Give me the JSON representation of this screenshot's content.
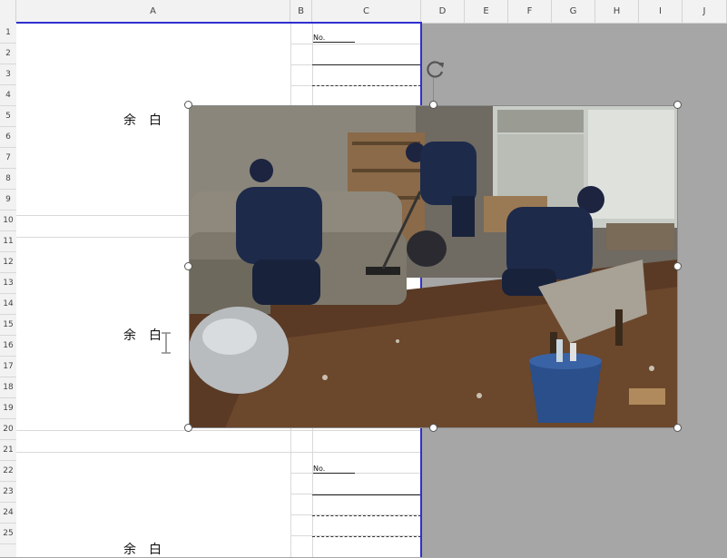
{
  "columns": [
    "A",
    "B",
    "C",
    "D",
    "E",
    "F",
    "G",
    "H",
    "I",
    "J"
  ],
  "rows": [
    "1",
    "2",
    "3",
    "4",
    "5",
    "6",
    "7",
    "8",
    "9",
    "10",
    "11",
    "12",
    "13",
    "14",
    "15",
    "16",
    "17",
    "18",
    "19",
    "20",
    "21",
    "22",
    "23",
    "24",
    "25"
  ],
  "cells": {
    "blank_label_1": "余　白",
    "blank_label_2": "余　白",
    "blank_label_3": "余　白",
    "no_label_1": "No.",
    "no_label_2": "No."
  },
  "picture": {
    "icon": "cleaning-photo-image",
    "selected": true
  },
  "colors": {
    "page_border": "#2f2fd0",
    "outside_area": "#a6a6a6"
  }
}
